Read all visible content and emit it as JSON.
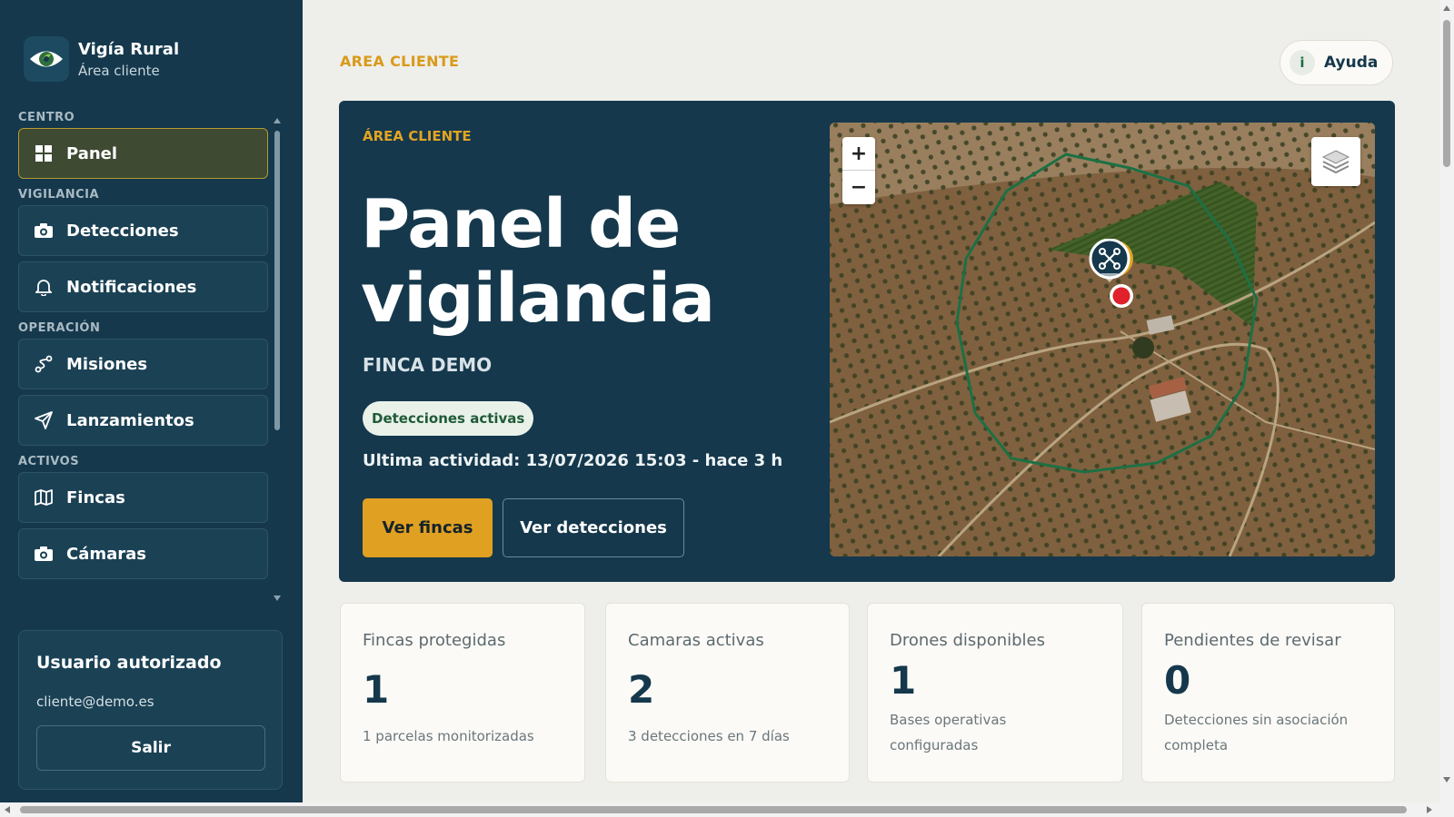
{
  "brand": {
    "title": "Vigía Rural",
    "subtitle": "Área cliente"
  },
  "nav": {
    "sections": [
      {
        "label": "CENTRO",
        "items": [
          {
            "label": "Panel",
            "icon": "grid-icon",
            "active": true
          }
        ]
      },
      {
        "label": "VIGILANCIA",
        "items": [
          {
            "label": "Detecciones",
            "icon": "camera-icon"
          },
          {
            "label": "Notificaciones",
            "icon": "bell-icon"
          }
        ]
      },
      {
        "label": "OPERACIÓN",
        "items": [
          {
            "label": "Misiones",
            "icon": "route-icon"
          },
          {
            "label": "Lanzamientos",
            "icon": "send-icon"
          }
        ]
      },
      {
        "label": "ACTIVOS",
        "items": [
          {
            "label": "Fincas",
            "icon": "map-icon"
          },
          {
            "label": "Cámaras",
            "icon": "camera-icon"
          }
        ]
      }
    ]
  },
  "user": {
    "title": "Usuario autorizado",
    "email": "cliente@demo.es",
    "logout_label": "Salir"
  },
  "header": {
    "eyebrow": "AREA CLIENTE",
    "help_label": "Ayuda",
    "help_icon_glyph": "i"
  },
  "hero": {
    "eyebrow": "ÁREA CLIENTE",
    "title": "Panel de vigilancia",
    "farm": "FINCA DEMO",
    "status": "Detecciones activas",
    "last_activity": "Ultima actividad: 13/07/2026 15:03 - hace 3 h",
    "primary_label": "Ver fincas",
    "secondary_label": "Ver detecciones"
  },
  "map": {
    "zoom_in": "+",
    "zoom_out": "−",
    "layers_icon": "layers-icon",
    "drone_icon": "drone-icon",
    "alert_icon": "alert-marker-icon"
  },
  "stats": [
    {
      "label": "Fincas protegidas",
      "value": "1",
      "note": "1 parcelas monitorizadas"
    },
    {
      "label": "Camaras activas",
      "value": "2",
      "note": "3 detecciones en 7 días"
    },
    {
      "label": "Drones disponibles",
      "value": "1",
      "note": "Bases operativas configuradas"
    },
    {
      "label": "Pendientes de revisar",
      "value": "0",
      "note": "Detecciones sin asociación completa"
    }
  ],
  "colors": {
    "sidebar": "#15384c",
    "accent": "#e0a021",
    "active_border": "#b49a30",
    "page_bg": "#eeeeea",
    "geofence": "#1f7a4a",
    "alert": "#e0202a"
  }
}
